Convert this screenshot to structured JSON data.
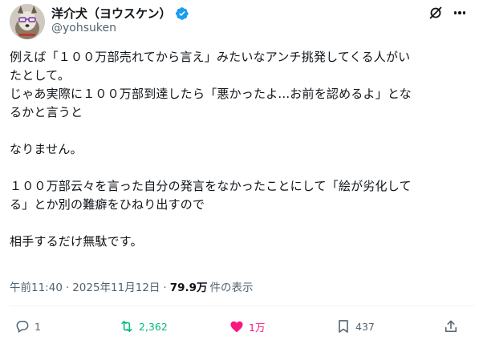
{
  "author": {
    "display_name": "洋介犬（ヨウスケン）",
    "handle": "@yohsuken",
    "verified": true
  },
  "tweet": {
    "text": "例えば「１００万部売れてから言え」みたいなアンチ挑発してくる人がい\nたとして。\nじゃあ実際に１００万部到達したら「悪かったよ...お前を認めるよ」とな\nるかと言うと\n\nなりません。\n\n１００万部云々を言った自分の発言をなかったことにして「絵が劣化して\nる」とか別の難癖をひねり出すので\n\n相手するだけ無駄です。"
  },
  "meta": {
    "time": "午前11:40",
    "date": "2025年11月12日",
    "separator": "·",
    "views_count": "79.9万",
    "views_label": "件の表示"
  },
  "actions": {
    "reply_count": "1",
    "retweet_count": "2,362",
    "like_count": "1万",
    "bookmark_count": "437"
  },
  "icons": {
    "verified": "verified-badge-icon",
    "grok": "grok-icon",
    "more": "more-icon",
    "reply": "reply-icon",
    "retweet": "retweet-icon",
    "like": "heart-icon",
    "bookmark": "bookmark-icon",
    "share": "share-icon"
  },
  "colors": {
    "text": "#0f1419",
    "secondary": "#536471",
    "verified": "#1d9bf0",
    "retweet_active": "#00ba7c",
    "like_active": "#f91880",
    "divider": "#eff3f4"
  }
}
